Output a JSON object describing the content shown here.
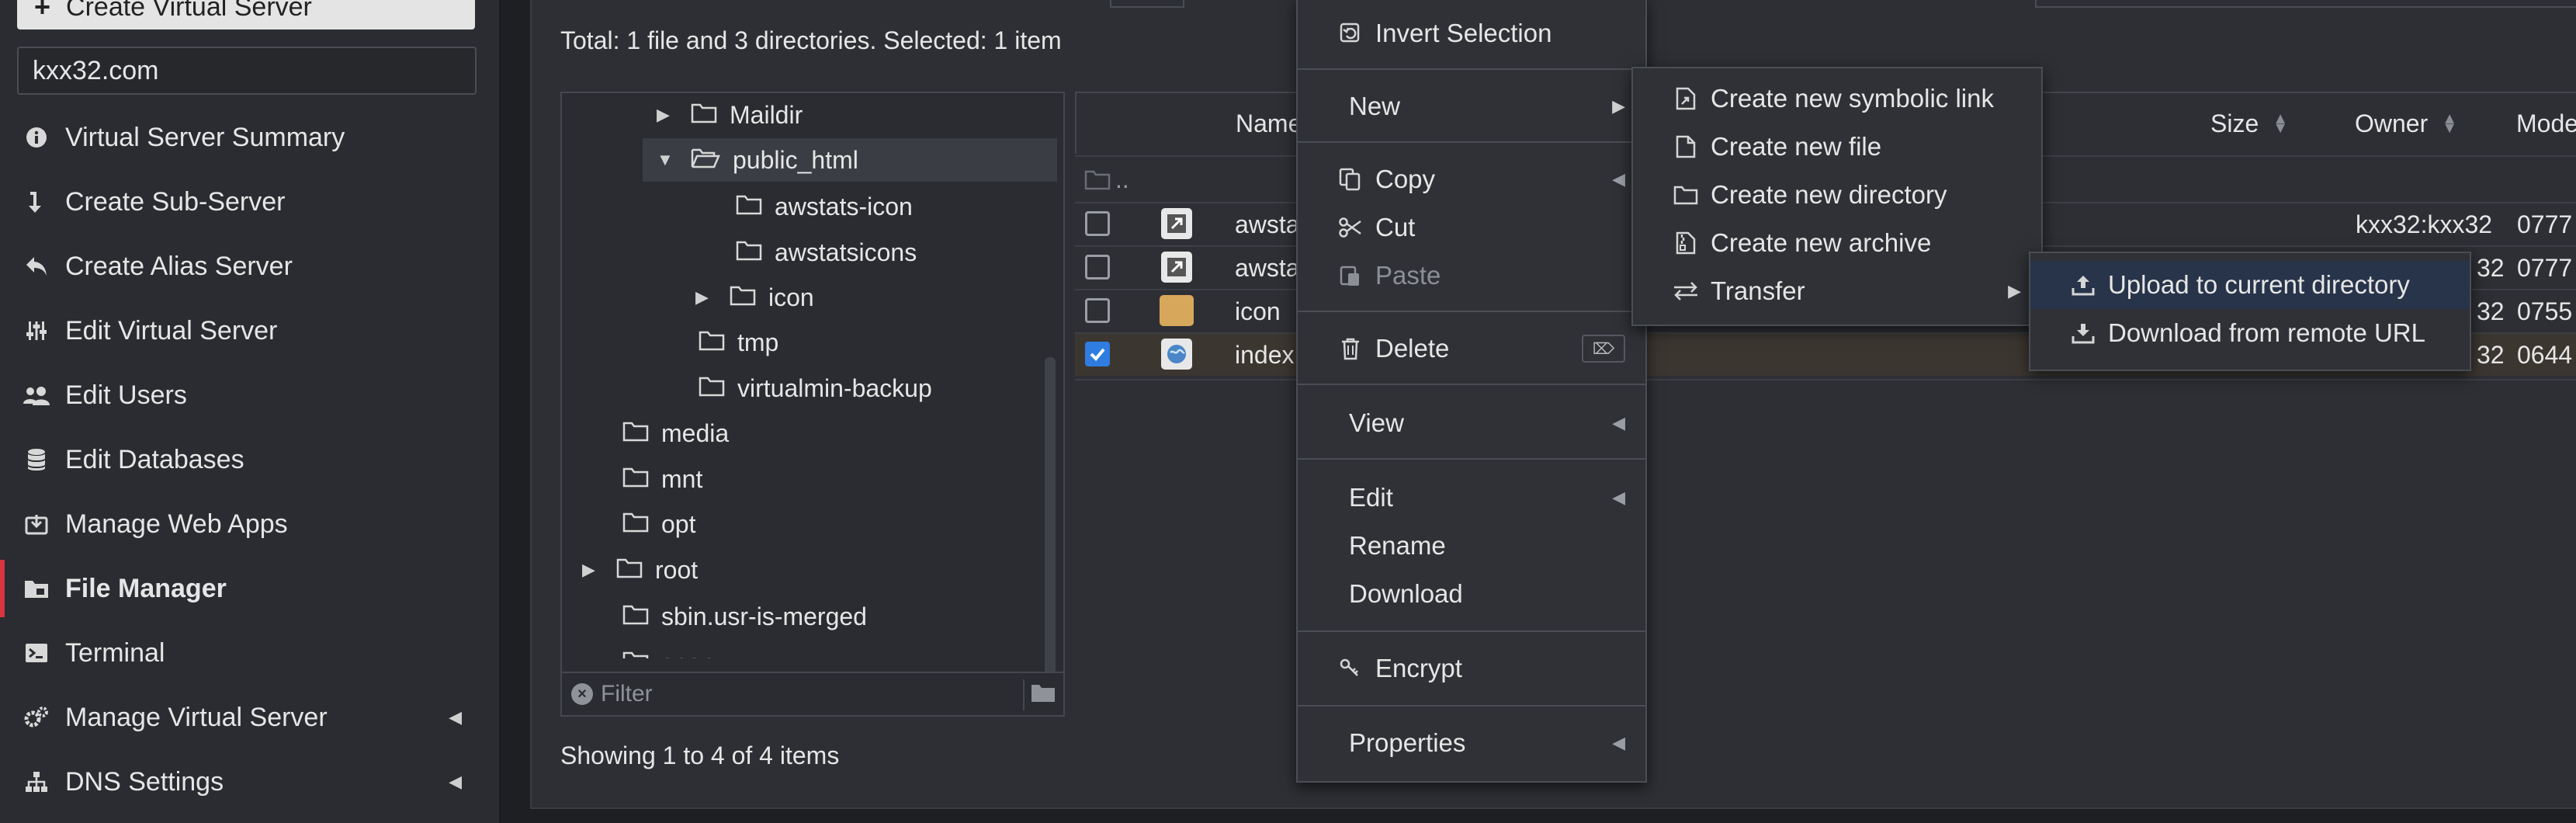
{
  "sidebar": {
    "create_button": "Create Virtual Server",
    "domain": "kxx32.com",
    "items": [
      {
        "label": "Virtual Server Summary",
        "icon": "info-circle-icon"
      },
      {
        "label": "Create Sub-Server",
        "icon": "arrow-down-right-icon"
      },
      {
        "label": "Create Alias Server",
        "icon": "reply-arrow-icon"
      },
      {
        "label": "Edit Virtual Server",
        "icon": "sliders-icon"
      },
      {
        "label": "Edit Users",
        "icon": "users-icon"
      },
      {
        "label": "Edit Databases",
        "icon": "database-icon"
      },
      {
        "label": "Manage Web Apps",
        "icon": "download-box-icon"
      },
      {
        "label": "File Manager",
        "icon": "folder-icon"
      },
      {
        "label": "Terminal",
        "icon": "terminal-icon"
      },
      {
        "label": "Manage Virtual Server",
        "icon": "gears-icon"
      },
      {
        "label": "DNS Settings",
        "icon": "sitemap-icon"
      }
    ]
  },
  "main": {
    "total_text": "Total: 1 file and 3 directories. Selected: 1 item",
    "showing_text": "Showing 1 to 4 of 4 items",
    "filter_placeholder": "Filter"
  },
  "tree": {
    "nodes": [
      {
        "label": "Maildir"
      },
      {
        "label": "public_html"
      },
      {
        "label": "awstats-icon"
      },
      {
        "label": "awstatsicons"
      },
      {
        "label": "icon"
      },
      {
        "label": "tmp"
      },
      {
        "label": "virtualmin-backup"
      },
      {
        "label": "media"
      },
      {
        "label": "mnt"
      },
      {
        "label": "opt"
      },
      {
        "label": "root"
      },
      {
        "label": "sbin.usr-is-merged"
      },
      {
        "label": "snap"
      }
    ]
  },
  "file_table": {
    "headers": {
      "name": "Name",
      "size": "Size",
      "owner": "Owner",
      "mode": "Mode"
    },
    "parent_row": "..",
    "rows": [
      {
        "name": "awsta",
        "owner": "kxx32:kxx32",
        "mode": "0777",
        "checked": false
      },
      {
        "name": "awsta",
        "owner": "32",
        "mode": "0777",
        "checked": false
      },
      {
        "name": "icon",
        "owner": "32",
        "mode": "0755",
        "checked": false
      },
      {
        "name": "index",
        "owner": "32",
        "mode": "0644",
        "checked": true
      }
    ]
  },
  "context_menu": {
    "items": {
      "invert_selection": "Invert Selection",
      "new": "New",
      "copy": "Copy",
      "cut": "Cut",
      "paste": "Paste",
      "delete": "Delete",
      "delete_key": "⌦",
      "view": "View",
      "edit": "Edit",
      "rename": "Rename",
      "download": "Download",
      "encrypt": "Encrypt",
      "properties": "Properties"
    }
  },
  "new_submenu": {
    "symlink": "Create new symbolic link",
    "file": "Create new file",
    "directory": "Create new directory",
    "archive": "Create new archive",
    "transfer": "Transfer"
  },
  "transfer_submenu": {
    "upload": "Upload to current directory",
    "download_remote": "Download from remote URL"
  },
  "colors": {
    "accent_active": "#d9333f",
    "checkbox_on": "#2f7de1",
    "folder_yellow": "#d7a75b"
  }
}
